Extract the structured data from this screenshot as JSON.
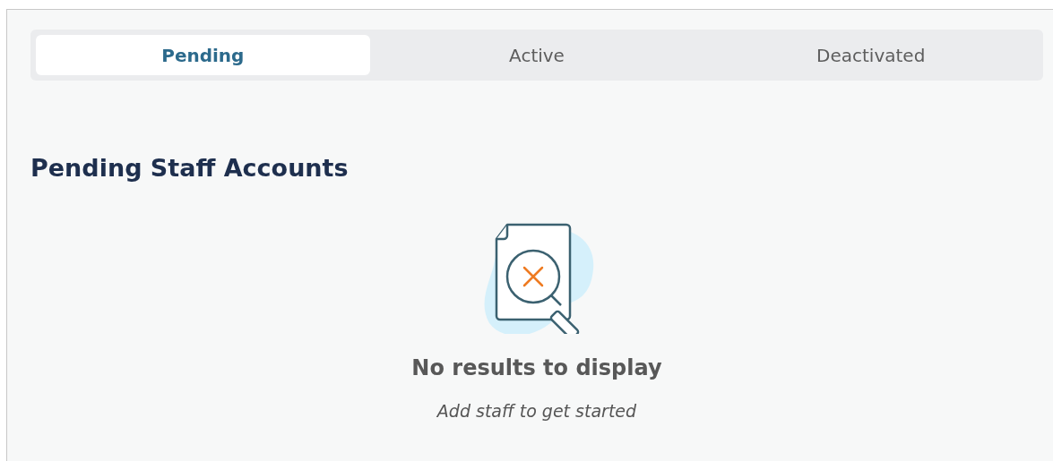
{
  "tabs": [
    {
      "label": "Pending",
      "selected": true
    },
    {
      "label": "Active",
      "selected": false
    },
    {
      "label": "Deactivated",
      "selected": false
    }
  ],
  "heading": "Pending Staff Accounts",
  "empty_state": {
    "title": "No results to display",
    "subtitle": "Add staff to get started"
  }
}
